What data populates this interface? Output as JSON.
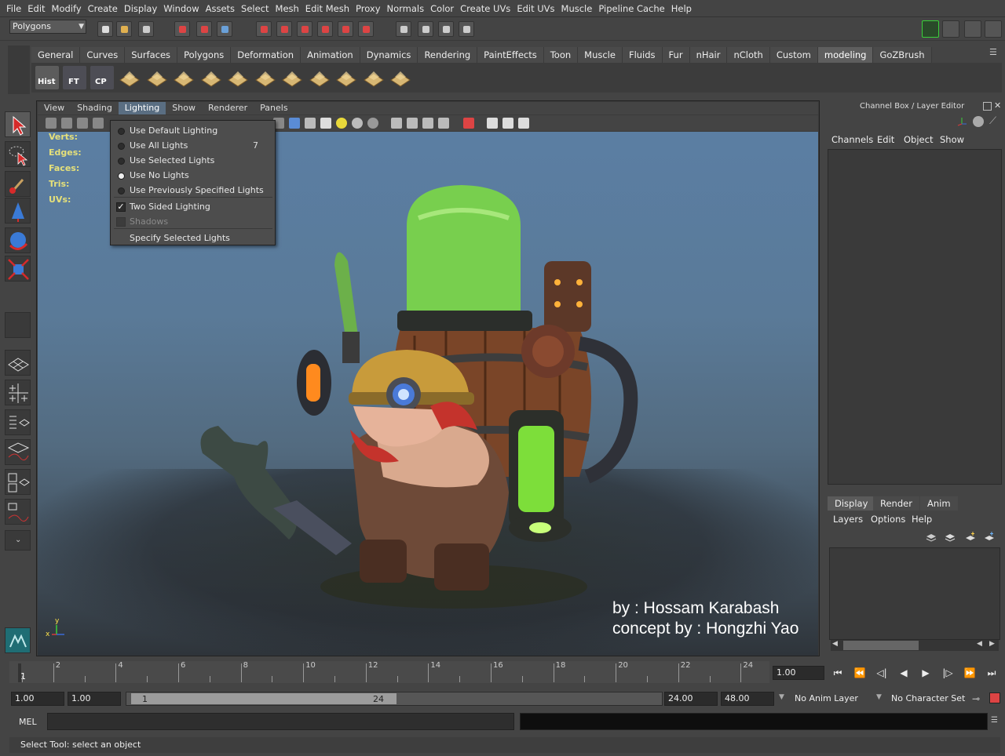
{
  "menubar": [
    "File",
    "Edit",
    "Modify",
    "Create",
    "Display",
    "Window",
    "Assets",
    "Select",
    "Mesh",
    "Edit Mesh",
    "Proxy",
    "Normals",
    "Color",
    "Create UVs",
    "Edit UVs",
    "Muscle",
    "Pipeline Cache",
    "Help"
  ],
  "status_line": {
    "mode": "Polygons"
  },
  "shelf": {
    "tabs": [
      "General",
      "Curves",
      "Surfaces",
      "Polygons",
      "Deformation",
      "Animation",
      "Dynamics",
      "Rendering",
      "PaintEffects",
      "Toon",
      "Muscle",
      "Fluids",
      "Fur",
      "nHair",
      "nCloth",
      "Custom",
      "modeling",
      "GoZBrush"
    ],
    "active_tab": "modeling",
    "labels": {
      "hist": "Hist",
      "ft": "FT",
      "cp": "CP"
    }
  },
  "viewport": {
    "menu": [
      "View",
      "Shading",
      "Lighting",
      "Show",
      "Renderer",
      "Panels"
    ],
    "open_menu": "Lighting",
    "hud": [
      "Verts:",
      "Edges:",
      "Faces:",
      "Tris:",
      "UVs:"
    ],
    "credit_line1": "by : Hossam Karabash",
    "credit_line2": "concept by : Hongzhi Yao",
    "axis_y": "y",
    "axis_x": "x"
  },
  "lighting_menu": {
    "items": [
      {
        "label": "Use Default Lighting",
        "kind": "radio",
        "on": false,
        "shortcut": ""
      },
      {
        "label": "Use All Lights",
        "kind": "radio",
        "on": false,
        "shortcut": "7"
      },
      {
        "label": "Use Selected Lights",
        "kind": "radio",
        "on": false,
        "shortcut": ""
      },
      {
        "label": "Use No Lights",
        "kind": "radio",
        "on": true,
        "shortcut": ""
      },
      {
        "label": "Use Previously Specified Lights",
        "kind": "radio",
        "on": false,
        "shortcut": ""
      },
      {
        "label": "Two Sided Lighting",
        "kind": "check",
        "on": true,
        "shortcut": ""
      },
      {
        "label": "Shadows",
        "kind": "check",
        "on": false,
        "disabled": true,
        "shortcut": ""
      },
      {
        "label": "Specify Selected Lights",
        "kind": "plain",
        "on": false,
        "shortcut": ""
      }
    ]
  },
  "channel_box": {
    "title": "Channel Box / Layer Editor",
    "menu": [
      "Channels",
      "Edit",
      "Object",
      "Show"
    ]
  },
  "layer_editor": {
    "tabs": [
      "Display",
      "Render",
      "Anim"
    ],
    "active_tab": "Display",
    "menu": [
      "Layers",
      "Options",
      "Help"
    ]
  },
  "timeline": {
    "ticks": [
      "2",
      "4",
      "6",
      "8",
      "10",
      "12",
      "14",
      "16",
      "18",
      "20",
      "22",
      "24"
    ],
    "current_frame": "1",
    "current_time_field": "1.00"
  },
  "range": {
    "start_field": "1.00",
    "inner_start_field": "1.00",
    "slider_start": "1",
    "slider_end": "24",
    "end_field": "24.00",
    "outer_end_field": "48.00",
    "anim_layer": "No Anim Layer",
    "char_set": "No Character Set"
  },
  "command_line": {
    "label": "MEL"
  },
  "help_line": "Select Tool: select an object",
  "colors": {
    "hud_yellow": "#e5e07a",
    "active_menu": "#5a6e82"
  }
}
